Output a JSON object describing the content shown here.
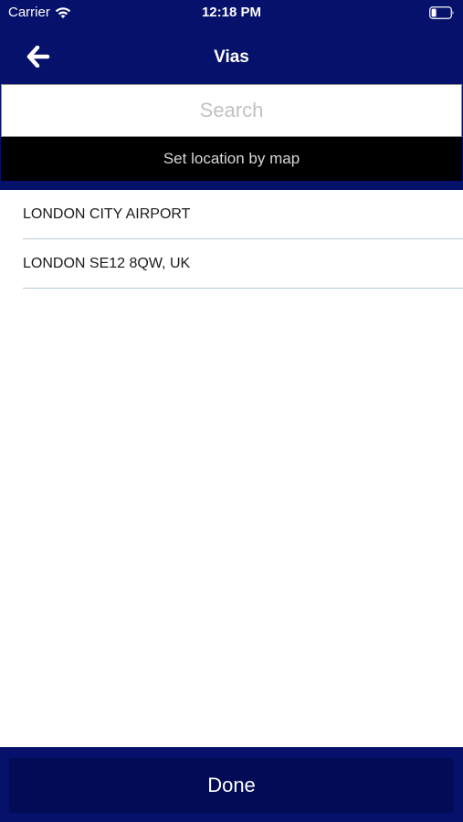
{
  "status_bar": {
    "carrier": "Carrier",
    "time": "12:18 PM",
    "wifi_icon": "wifi-icon",
    "battery_icon": "battery-icon"
  },
  "nav": {
    "title": "Vias",
    "back_icon": "back-arrow-icon"
  },
  "search": {
    "placeholder": "Search",
    "value": "",
    "map_button_label": "Set location by map"
  },
  "results": [
    {
      "label": "LONDON CITY AIRPORT"
    },
    {
      "label": "LONDON SE12 8QW, UK"
    }
  ],
  "footer": {
    "done_label": "Done"
  },
  "colors": {
    "header_bg": "#05116b",
    "done_bg": "#020b55",
    "map_button_bg": "#000000",
    "divider": "#b9cbd8"
  }
}
